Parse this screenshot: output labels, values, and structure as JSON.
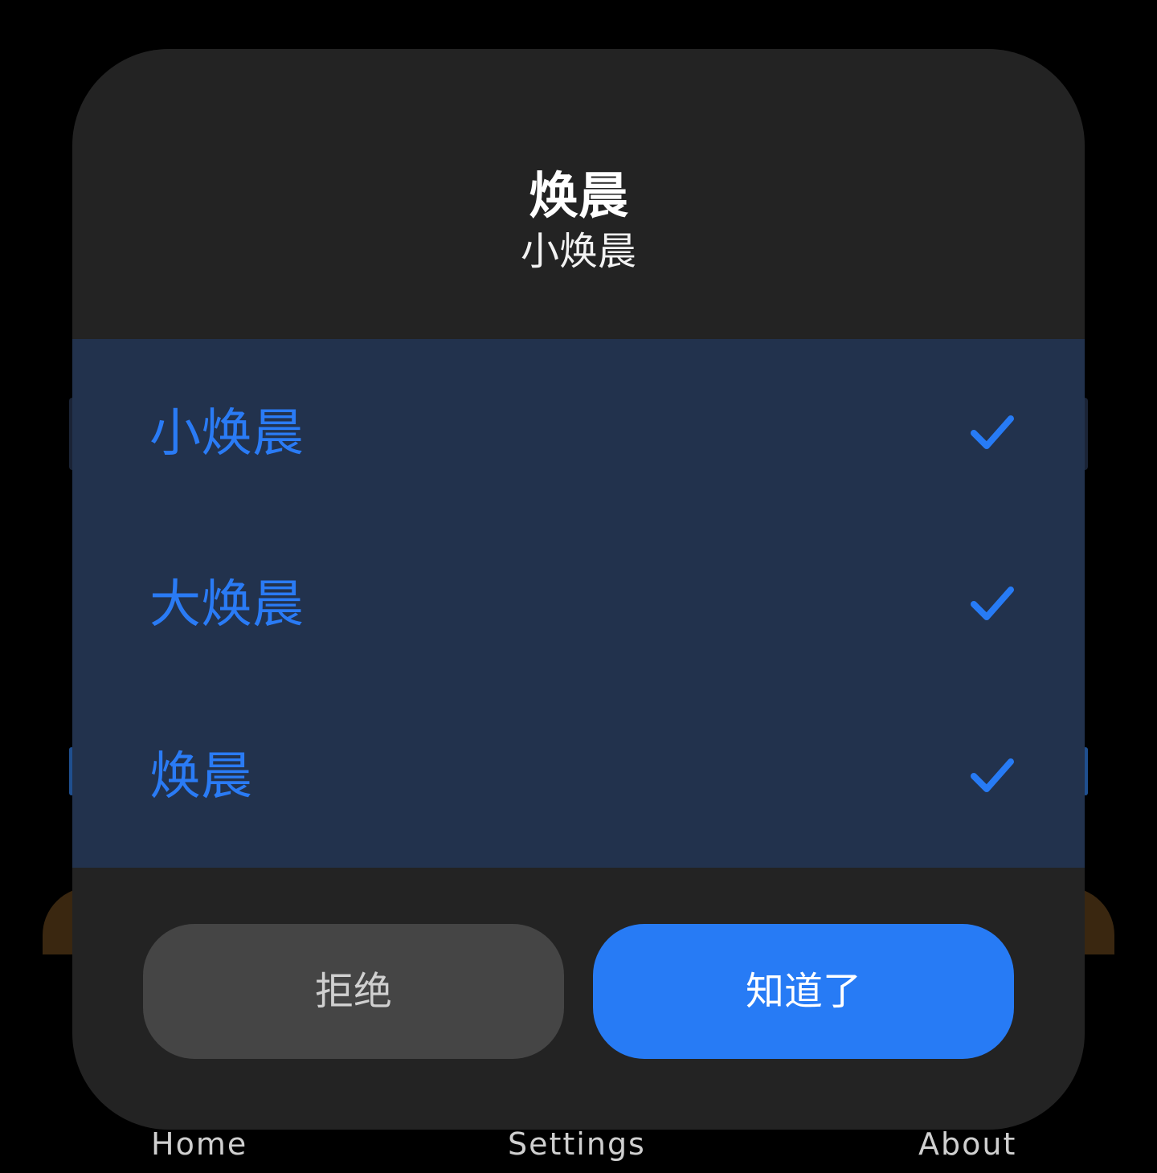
{
  "dialog": {
    "title": "焕晨",
    "subtitle": "小焕晨",
    "items": [
      {
        "label": "小焕晨",
        "checked": true,
        "icon": "check-icon"
      },
      {
        "label": "大焕晨",
        "checked": true,
        "icon": "check-icon"
      },
      {
        "label": "焕晨",
        "checked": true,
        "icon": "check-icon"
      }
    ],
    "reject_label": "拒绝",
    "ok_label": "知道了"
  },
  "tabbar": {
    "home": "Home",
    "settings": "Settings",
    "about": "About"
  },
  "colors": {
    "accent": "#277bf5",
    "dialog_bg": "#232323",
    "list_bg": "#22324d",
    "reject_bg": "#454545"
  }
}
